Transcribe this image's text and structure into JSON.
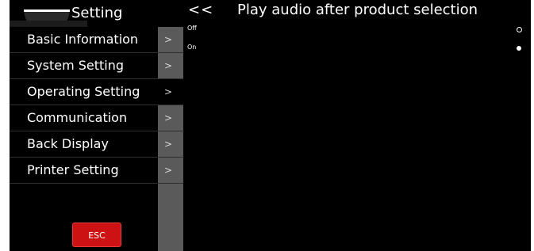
{
  "sidebar": {
    "title": "Setting",
    "items": [
      {
        "label": "Basic Information",
        "arrow": ">"
      },
      {
        "label": "System Setting",
        "arrow": ">"
      },
      {
        "label": "Operating Setting",
        "arrow": ">"
      },
      {
        "label": "Communication",
        "arrow": ">"
      },
      {
        "label": "Back Display",
        "arrow": ">"
      },
      {
        "label": "Printer Setting",
        "arrow": ">"
      }
    ],
    "active_item": "Operating Setting",
    "esc_label": "ESC"
  },
  "header": {
    "back_label": "<<",
    "title": "Play audio after product selection"
  },
  "options": [
    {
      "label": "Off",
      "selected": false
    },
    {
      "label": "On",
      "selected": true
    }
  ],
  "colors": {
    "background": "#000000",
    "menu_arrow_bg": "#5a5a5a",
    "esc_button": "#cc1212",
    "text": "#ffffff"
  }
}
